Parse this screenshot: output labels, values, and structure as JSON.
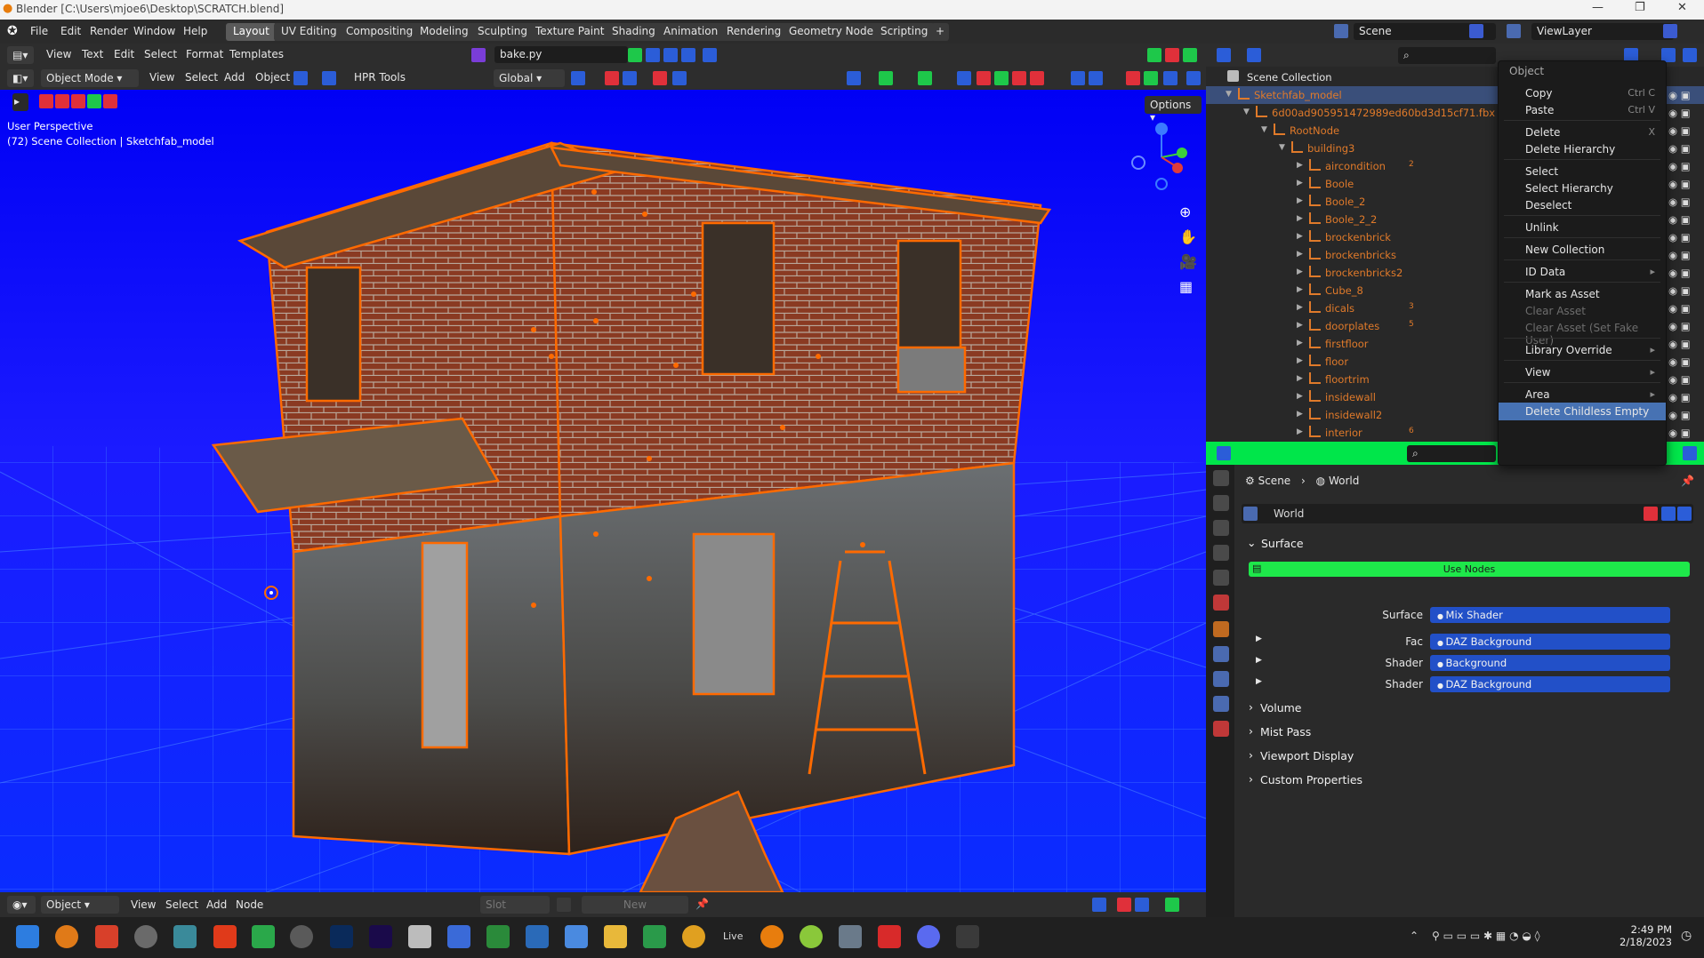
{
  "window": {
    "title": "Blender [C:\\Users\\mjoe6\\Desktop\\SCRATCH.blend]"
  },
  "menu": [
    "File",
    "Edit",
    "Render",
    "Window",
    "Help"
  ],
  "workspaces": [
    "Layout",
    "UV Editing",
    "Compositing",
    "Modeling",
    "Sculpting",
    "Texture Paint",
    "Shading",
    "Animation",
    "Rendering",
    "Geometry Nodes",
    "Scripting"
  ],
  "active_workspace": "Layout",
  "scene": {
    "label": "Scene",
    "viewlayer": "ViewLayer"
  },
  "text_editor": {
    "menus": [
      "View",
      "Text",
      "Edit",
      "Select",
      "Format",
      "Templates"
    ],
    "file": "bake.py"
  },
  "viewport": {
    "mode": "Object Mode",
    "menus": [
      "View",
      "Select",
      "Add",
      "Object"
    ],
    "addon": "HPR Tools",
    "orientation": "Global",
    "options_label": "Options",
    "overlay_line1": "User Perspective",
    "overlay_line2": "(72) Scene Collection | Sketchfab_model",
    "bg_color": "#0a0aff",
    "outline_color": "#ff6a00"
  },
  "node_editor": {
    "mode": "Object",
    "menus": [
      "View",
      "Select",
      "Add",
      "Node"
    ],
    "slot": "Slot",
    "new": "New"
  },
  "outliner": {
    "root": "Scene Collection",
    "items": [
      {
        "label": "Sketchfab_model",
        "depth": 0,
        "selected": true
      },
      {
        "label": "6d00ad905951472989ed60bd3d15cf71.fbx",
        "depth": 1
      },
      {
        "label": "RootNode",
        "depth": 2
      },
      {
        "label": "building3",
        "depth": 3
      },
      {
        "label": "aircondition",
        "depth": 4,
        "badge": "2"
      },
      {
        "label": "Boole",
        "depth": 4
      },
      {
        "label": "Boole_2",
        "depth": 4
      },
      {
        "label": "Boole_2_2",
        "depth": 4
      },
      {
        "label": "brockenbrick",
        "depth": 4
      },
      {
        "label": "brockenbricks",
        "depth": 4
      },
      {
        "label": "brockenbricks2",
        "depth": 4
      },
      {
        "label": "Cube_8",
        "depth": 4
      },
      {
        "label": "dicals",
        "depth": 4,
        "badge": "3"
      },
      {
        "label": "doorplates",
        "depth": 4,
        "badge": "5"
      },
      {
        "label": "firstfloor",
        "depth": 4
      },
      {
        "label": "floor",
        "depth": 4
      },
      {
        "label": "floortrim",
        "depth": 4
      },
      {
        "label": "insidewall",
        "depth": 4
      },
      {
        "label": "insidewall2",
        "depth": 4
      },
      {
        "label": "interior",
        "depth": 4,
        "badge": "6"
      }
    ]
  },
  "context_menu": {
    "title": "Object",
    "items": [
      {
        "label": "Copy",
        "key": "Ctrl C"
      },
      {
        "label": "Paste",
        "key": "Ctrl V"
      },
      {
        "sep": true
      },
      {
        "label": "Delete",
        "key": "X"
      },
      {
        "label": "Delete Hierarchy"
      },
      {
        "sep": true
      },
      {
        "label": "Select"
      },
      {
        "label": "Select Hierarchy"
      },
      {
        "label": "Deselect"
      },
      {
        "sep": true
      },
      {
        "label": "Unlink"
      },
      {
        "sep": true
      },
      {
        "label": "New Collection"
      },
      {
        "sep": true
      },
      {
        "label": "ID Data",
        "sub": true
      },
      {
        "sep": true
      },
      {
        "label": "Mark as Asset"
      },
      {
        "label": "Clear Asset",
        "disabled": true
      },
      {
        "label": "Clear Asset (Set Fake User)",
        "disabled": true
      },
      {
        "sep": true
      },
      {
        "label": "Library Override",
        "sub": true
      },
      {
        "sep": true
      },
      {
        "label": "View",
        "sub": true
      },
      {
        "sep": true
      },
      {
        "label": "Area",
        "sub": true
      },
      {
        "label": "Delete Childless Empty",
        "highlighted": true
      }
    ]
  },
  "properties": {
    "breadcrumb": [
      "Scene",
      "World"
    ],
    "world_name": "World",
    "sections": {
      "surface": "Surface",
      "use_nodes": "Use Nodes",
      "volume": "Volume",
      "mist": "Mist Pass",
      "viewport_display": "Viewport Display",
      "custom": "Custom Properties"
    },
    "fields": [
      {
        "label": "Surface",
        "value": "Mix Shader"
      },
      {
        "label": "Fac",
        "value": "DAZ Background"
      },
      {
        "label": "Shader",
        "value": "Background"
      },
      {
        "label": "Shader",
        "value": "DAZ Background"
      }
    ]
  },
  "taskbar": {
    "time": "2:49 PM",
    "date": "2/18/2023",
    "live": "Live"
  }
}
